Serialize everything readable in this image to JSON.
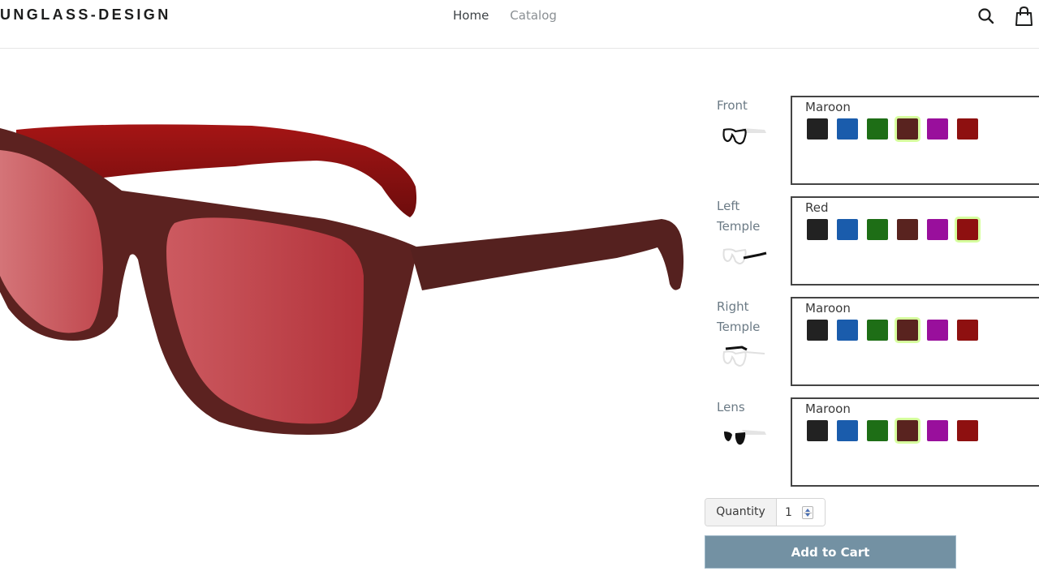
{
  "header": {
    "logo": "UNGLASS-DESIGN",
    "nav": [
      {
        "label": "Home",
        "active": true
      },
      {
        "label": "Catalog",
        "active": false
      }
    ],
    "icons": [
      "search-icon",
      "shopping-bag-icon"
    ]
  },
  "viewer": {
    "product_image": "sunglasses-3d-preview",
    "frame_color": "#5a2220",
    "temple_color": "#8e1010",
    "lens_color": "#b83a42"
  },
  "colors": [
    {
      "name": "Black",
      "hex": "#222222"
    },
    {
      "name": "Blue",
      "hex": "#1a5cac"
    },
    {
      "name": "Green",
      "hex": "#1e6e16"
    },
    {
      "name": "Maroon",
      "hex": "#59231f"
    },
    {
      "name": "Purple",
      "hex": "#990f9c"
    },
    {
      "name": "Red",
      "hex": "#8e1010"
    }
  ],
  "options": [
    {
      "label_line1": "Front",
      "label_line2": "",
      "thumb": "front-part-icon",
      "selected_name": "Maroon",
      "selected_index": 3
    },
    {
      "label_line1": "Left",
      "label_line2": "Temple",
      "thumb": "left-temple-part-icon",
      "selected_name": "Red",
      "selected_index": 5
    },
    {
      "label_line1": "Right",
      "label_line2": "Temple",
      "thumb": "right-temple-part-icon",
      "selected_name": "Maroon",
      "selected_index": 3
    },
    {
      "label_line1": "Lens",
      "label_line2": "",
      "thumb": "lens-part-icon",
      "selected_name": "Maroon",
      "selected_index": 3
    }
  ],
  "quantity": {
    "label": "Quantity",
    "value": "1"
  },
  "add_to_cart": {
    "label": "Add to Cart"
  }
}
